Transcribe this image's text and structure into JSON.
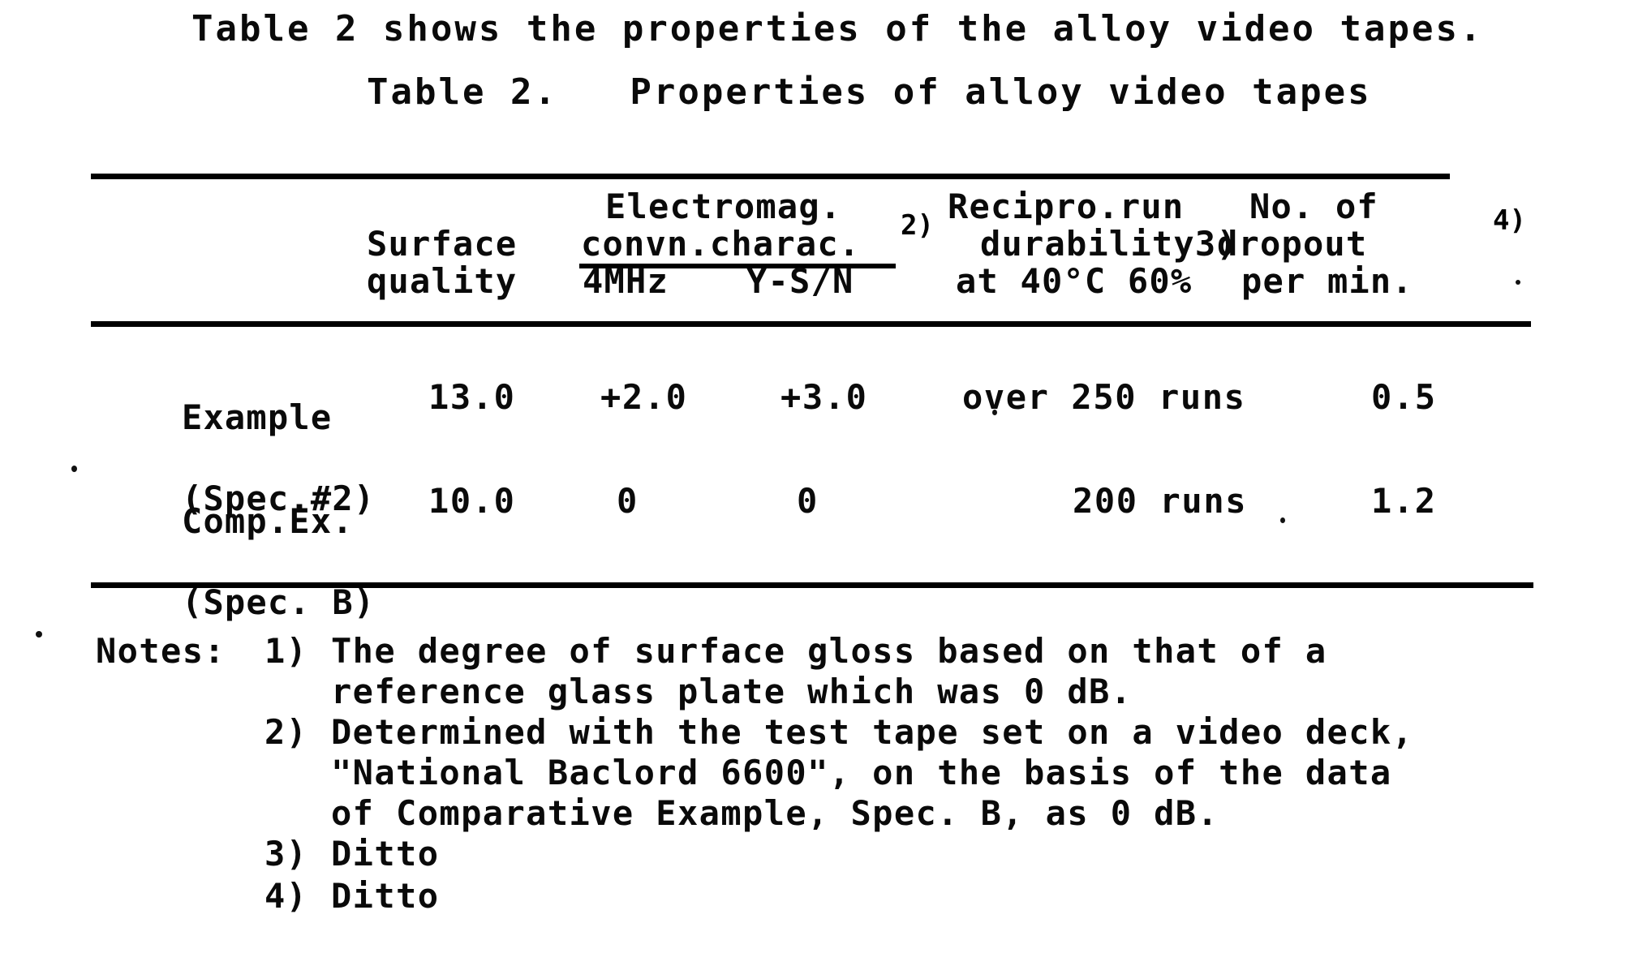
{
  "document": {
    "intro_sentence": "Table 2 shows the properties of the alloy video tapes.",
    "table_caption": "Table 2.   Properties of alloy video tapes"
  },
  "table": {
    "header": {
      "col_surface_line1": "Surface",
      "col_surface_line2": "quality",
      "col_electromag_line1": "Electromag.",
      "col_electromag_line2": "convn.charac.",
      "col_electromag_footnote": "2)",
      "sub_4mhz": "4MHz",
      "sub_ysn": "Y-S/N",
      "col_durability_line1": "Recipro.run",
      "col_durability_line2": "durability3)",
      "col_durability_line3": "at 40°C 60%",
      "col_dropout_line1": "No. of",
      "col_dropout_line2": "dropout",
      "col_dropout_footnote": "4)",
      "col_dropout_line3": "per min."
    },
    "rows": [
      {
        "label_line1": "Example",
        "label_line2": "(Spec.#2)",
        "surface_quality": "13.0",
        "em_4mhz": "+2.0",
        "em_ysn": "+3.0",
        "durability": "over 250 runs",
        "dropout": "0.5"
      },
      {
        "label_line1": "Comp.Ex.",
        "label_line2": "(Spec. B)",
        "surface_quality": "10.0",
        "em_4mhz": "0",
        "em_ysn": "0",
        "durability": "200 runs",
        "dropout": "1.2"
      }
    ]
  },
  "notes": {
    "label": "Notes:",
    "items": [
      {
        "number": "1)",
        "lines": [
          "The degree of surface gloss based on that of a",
          "reference glass plate which was 0 dB."
        ]
      },
      {
        "number": "2)",
        "lines": [
          "Determined with the test tape set on a video deck,",
          "\"National Baclord 6600\", on the basis of the data",
          "of Comparative Example, Spec. B, as 0 dB."
        ]
      },
      {
        "number": "3)",
        "lines": [
          "Ditto"
        ]
      },
      {
        "number": "4)",
        "lines": [
          "Ditto"
        ]
      }
    ]
  },
  "chart_data": {
    "type": "table",
    "title": "Table 2.   Properties of alloy video tapes",
    "columns": [
      "",
      "Surface quality",
      "Electromag. convn.charac. 4MHz",
      "Electromag. convn.charac. Y-S/N",
      "Recipro.run durability at 40°C 60%",
      "No. of dropout per min."
    ],
    "rows": [
      [
        "Example (Spec.#2)",
        "13.0",
        "+2.0",
        "+3.0",
        "over 250 runs",
        "0.5"
      ],
      [
        "Comp.Ex. (Spec. B)",
        "10.0",
        "0",
        "0",
        "200 runs",
        "1.2"
      ]
    ]
  },
  "colors": {
    "ink": "#0a0a0a",
    "paper": "#ffffff"
  }
}
